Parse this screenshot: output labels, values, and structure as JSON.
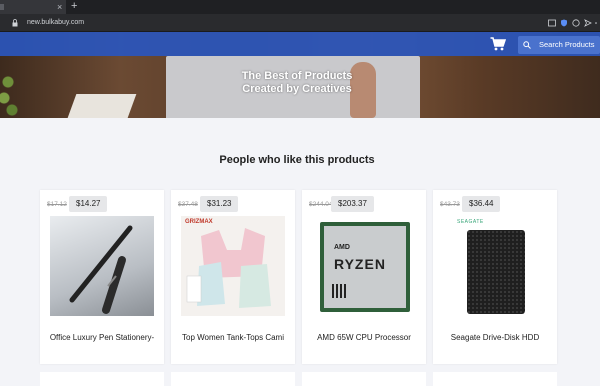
{
  "browser": {
    "tab_close": "×",
    "new_tab": "+",
    "url": "new.bulkabuy.com"
  },
  "header": {
    "search_placeholder": "Search Products"
  },
  "hero": {
    "title_line1": "The Best of Products",
    "title_line2": "Created by Creatives"
  },
  "section": {
    "title": "People who like this products"
  },
  "products": [
    {
      "old_price": "$17.12",
      "price": "$14.27",
      "name": "Office Luxury Pen Stationery-"
    },
    {
      "old_price": "$37.48",
      "price": "$31.23",
      "name": "Top Women Tank-Tops Cami",
      "img_label": "GRIZMAX"
    },
    {
      "old_price": "$244.04",
      "price": "$203.37",
      "name": "AMD 65W CPU Processor",
      "img_chip_line1": "AMD",
      "img_chip_line2": "RYZEN"
    },
    {
      "old_price": "$43.73",
      "price": "$36.44",
      "name": "Seagate Drive-Disk HDD",
      "img_brand": "SEAGATE"
    }
  ],
  "colors": {
    "navbar": "#2a56bd",
    "page_bg": "#f3f4f8"
  }
}
